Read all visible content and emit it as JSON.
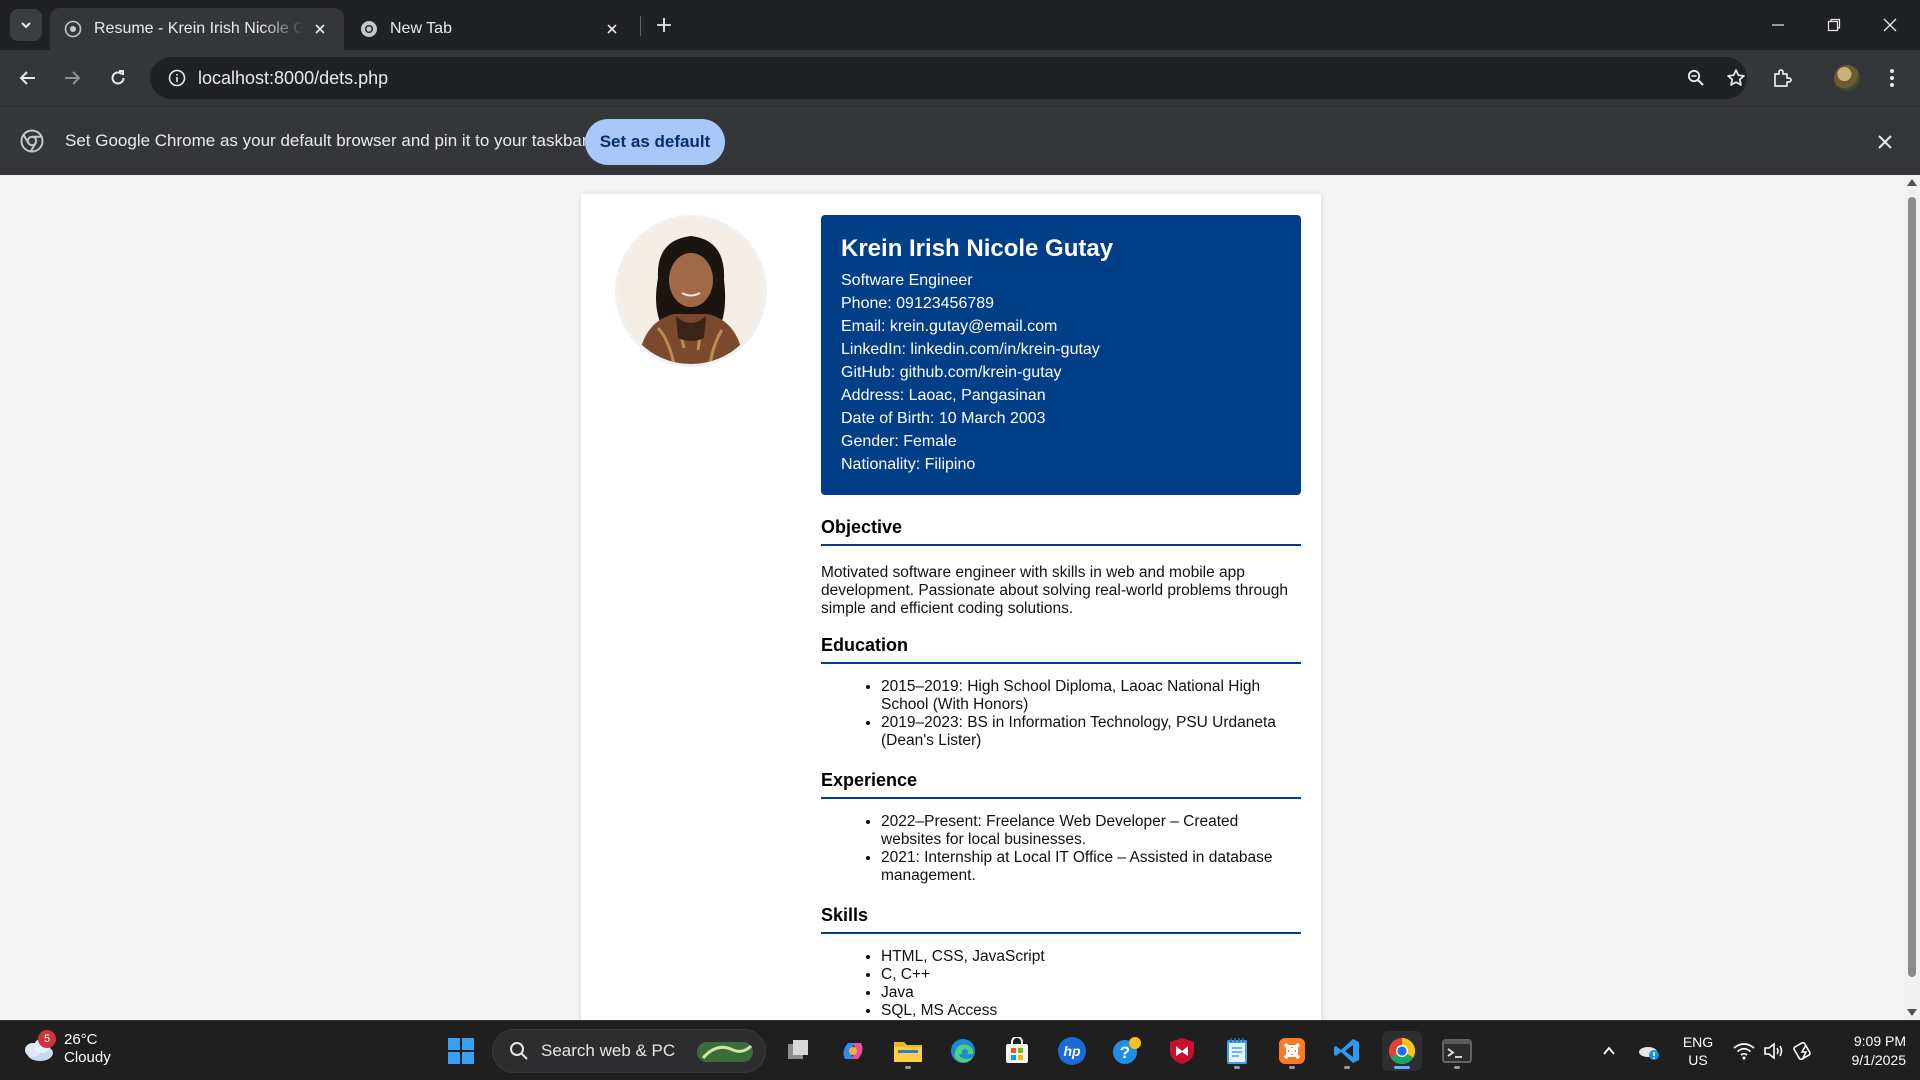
{
  "browser": {
    "tabs": [
      {
        "title": "Resume - Krein Irish Nicole Gutay",
        "active": true
      },
      {
        "title": "New Tab",
        "active": false
      }
    ],
    "url": "localhost:8000/dets.php",
    "infobar": {
      "message": "Set Google Chrome as your default browser and pin it to your taskbar",
      "button": "Set as default"
    }
  },
  "resume": {
    "name": "Krein Irish Nicole Gutay",
    "details": [
      "Software Engineer",
      "Phone: 09123456789",
      "Email: krein.gutay@email.com",
      "LinkedIn: linkedin.com/in/krein-gutay",
      "GitHub: github.com/krein-gutay",
      "Address: Laoac, Pangasinan",
      "Date of Birth: 10 March 2003",
      "Gender: Female",
      "Nationality: Filipino"
    ],
    "objective": {
      "heading": "Objective",
      "text": "Motivated software engineer with skills in web and mobile app development. Passionate about solving real-world problems through simple and efficient coding solutions."
    },
    "education": {
      "heading": "Education",
      "items": [
        "2015–2019: High School Diploma, Laoac National High School (With Honors)",
        "2019–2023: BS in Information Technology, PSU Urdaneta (Dean's Lister)"
      ]
    },
    "experience": {
      "heading": "Experience",
      "items": [
        "2022–Present: Freelance Web Developer – Created websites for local businesses.",
        "2021: Internship at Local IT Office – Assisted in database management."
      ]
    },
    "skills": {
      "heading": "Skills",
      "items": [
        "HTML, CSS, JavaScript",
        "C, C++",
        "Java",
        "SQL, MS Access"
      ]
    },
    "colors": {
      "header_bg": "#003f87",
      "rule": "#003f87"
    }
  },
  "taskbar": {
    "weather": {
      "temp": "26°C",
      "condition": "Cloudy",
      "badge": "5"
    },
    "search_placeholder": "Search web & PC",
    "lang": {
      "line1": "ENG",
      "line2": "US"
    },
    "clock": {
      "time": "9:09 PM",
      "date": "9/1/2025"
    }
  }
}
